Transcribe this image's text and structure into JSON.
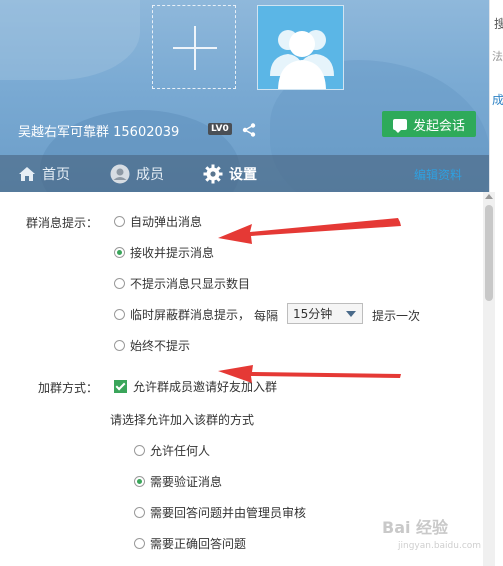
{
  "header": {
    "group_name": "吴越右军可靠群 15602039",
    "level_badge": "LV0",
    "chat_button_label": "发起会话"
  },
  "nav": {
    "tabs": [
      {
        "label": "首页",
        "icon": "home-icon"
      },
      {
        "label": "成员",
        "icon": "user-icon"
      },
      {
        "label": "设置",
        "icon": "gear-icon",
        "active": true
      }
    ],
    "edit_link": "编辑资料"
  },
  "right_strip": {
    "text1": "搜",
    "text2": "法",
    "text3": "成"
  },
  "settings": {
    "message_notice_label": "群消息提示：",
    "message_options": [
      {
        "label": "自动弹出消息",
        "checked": false
      },
      {
        "label": "接收并提示消息",
        "checked": true
      },
      {
        "label": "不提示消息只显示数目",
        "checked": false
      },
      {
        "label": "临时屏蔽群消息提示，",
        "checked": false
      },
      {
        "label": "始终不提示",
        "checked": false
      }
    ],
    "every_label": "每隔",
    "interval_select": "15分钟",
    "remind_once_label": "提示一次",
    "join_method_label": "加群方式：",
    "allow_invite_label": "允许群成员邀请好友加入群",
    "allow_invite_checked": true,
    "choose_method_label": "请选择允许加入该群的方式",
    "join_options": [
      {
        "label": "允许任何人",
        "checked": false
      },
      {
        "label": "需要验证消息",
        "checked": true
      },
      {
        "label": "需要回答问题并由管理员审核",
        "checked": false
      },
      {
        "label": "需要正确回答问题",
        "checked": false
      }
    ]
  },
  "watermark": {
    "text": "Bai 经验",
    "sub": "jingyan.baidu.com"
  },
  "colors": {
    "accent_green": "#3aa55a",
    "button_green": "#2eaa5a",
    "annotation_red": "#e53935",
    "link_blue": "#2fa0e0"
  }
}
